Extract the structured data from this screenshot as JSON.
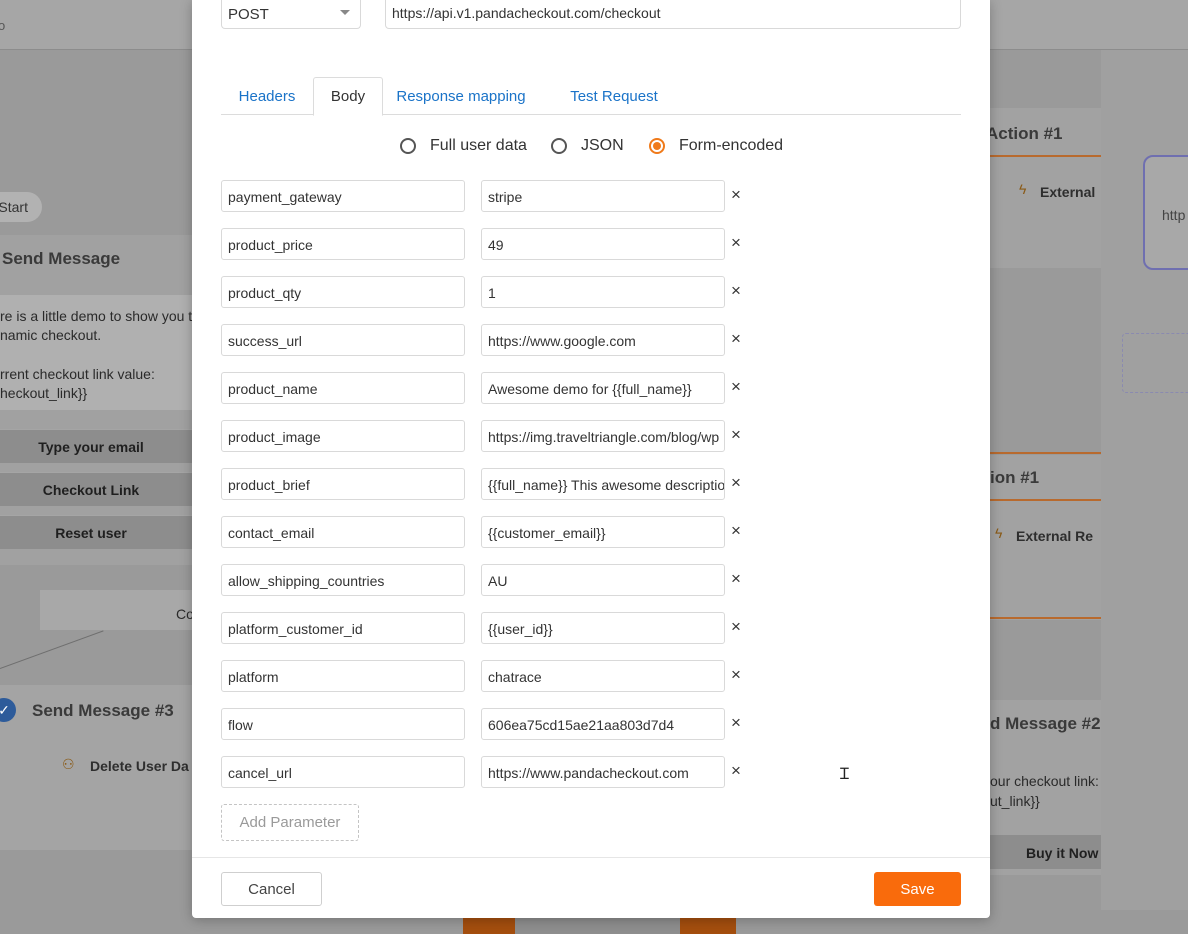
{
  "background": {
    "top_fragment": "o",
    "left": {
      "start_pill": "Start",
      "card_title": "Send Message",
      "message_line1": "re is a little demo to show you th",
      "message_line2": "namic checkout.",
      "message_line3": "rrent checkout link value:",
      "message_line4": "heckout_link}}",
      "buttons": [
        "Type your email",
        "Checkout Link",
        "Reset user"
      ],
      "connector_label": "Co",
      "send_message_3": "Send Message #3",
      "delete_user": "Delete User Da"
    },
    "right": {
      "action_1_title": "Action #1",
      "external_1": "External",
      "http_fragment": "http",
      "action_1b_title": "ion #1",
      "external_2": "External Re",
      "send_message_2": "d Message #2",
      "checkout_line1": "our checkout link:",
      "checkout_line2": "ut_link}}",
      "buy_it_now": "Buy it Now"
    }
  },
  "modal": {
    "method": "POST",
    "url": "https://api.v1.pandacheckout.com/checkout",
    "tabs": [
      {
        "label": "Headers",
        "active": false
      },
      {
        "label": "Body",
        "active": true
      },
      {
        "label": "Response mapping",
        "active": false
      },
      {
        "label": "Test Request",
        "active": false
      }
    ],
    "body_types": [
      {
        "label": "Full user data",
        "checked": false
      },
      {
        "label": "JSON",
        "checked": false
      },
      {
        "label": "Form-encoded",
        "checked": true
      }
    ],
    "params": [
      {
        "key": "payment_gateway",
        "value": "stripe"
      },
      {
        "key": "product_price",
        "value": "49"
      },
      {
        "key": "product_qty",
        "value": "1"
      },
      {
        "key": "success_url",
        "value": "https://www.google.com"
      },
      {
        "key": "product_name",
        "value": "Awesome demo for {{full_name}}"
      },
      {
        "key": "product_image",
        "value": "https://img.traveltriangle.com/blog/wp"
      },
      {
        "key": "product_brief",
        "value": "{{full_name}} This awesome description"
      },
      {
        "key": "contact_email",
        "value": "{{customer_email}}"
      },
      {
        "key": "allow_shipping_countries",
        "value": "AU"
      },
      {
        "key": "platform_customer_id",
        "value": "{{user_id}}"
      },
      {
        "key": "platform",
        "value": "chatrace"
      },
      {
        "key": "flow",
        "value": "606ea75cd15ae21aa803d7d4"
      },
      {
        "key": "cancel_url",
        "value": "https://www.pandacheckout.com"
      }
    ],
    "remove_symbol": "×",
    "add_parameter_label": "Add Parameter",
    "cancel_label": "Cancel",
    "save_label": "Save"
  },
  "colors": {
    "accent": "#f96b0c",
    "link": "#1a73c8",
    "radio_checked": "#f07a1a"
  },
  "icons": {
    "cursor": "text-cursor-icon",
    "remove": "close-icon"
  }
}
